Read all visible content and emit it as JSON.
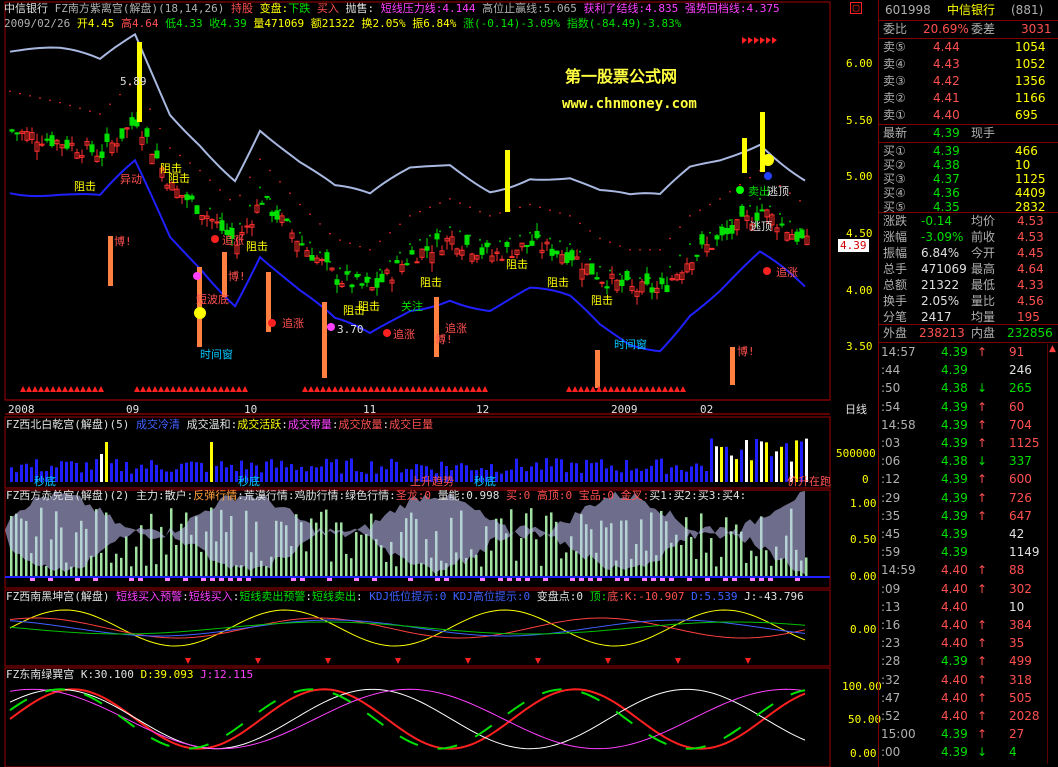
{
  "stock": {
    "name": "中信银行",
    "code": "601998",
    "seq": "(881)"
  },
  "top_title": {
    "name": "中信银行",
    "formula": "FZ南方紫离宫(解盘)",
    "params": "(18,14,26)",
    "hold": "持股",
    "change": "变盘:",
    "down": "下跌",
    "buy": "买入",
    "sell": "抛售:",
    "l1": "短线压力线:4.144",
    "l2": "高位止赢线:5.065",
    "l3": "获利了结线:4.835",
    "l4": "强势回档线:4.375"
  },
  "ohlc_line": {
    "date": "2009/02/26",
    "open": "开4.45",
    "high": "高4.64",
    "low": "低4.33",
    "close": "收4.39",
    "vol": "量471069",
    "amt": "额21322",
    "turn": "换2.05%",
    "amp": "振6.84%",
    "chg": "涨(-0.14)-3.09%",
    "idx": "指数(-84.49)-3.83%"
  },
  "watermark": {
    "line1": "第一股票公式网",
    "line2": "www.chnmoney.com"
  },
  "main_axis": [
    "6.00",
    "5.50",
    "5.00",
    "4.50",
    "4.00",
    "3.50"
  ],
  "price_tag": "4.39",
  "annot": {
    "peak": "5.89",
    "low": "3.70",
    "zuji": "阻击",
    "yidong": "异动",
    "zhuizhang": "追涨",
    "bo": "博!",
    "duanbo": "短波底",
    "shijian": "时间窗",
    "guanzhu": "关注",
    "mai": "卖出",
    "taoding": "逃顶",
    "ji": "击",
    "xiang": "向"
  },
  "time_axis": [
    "2008",
    "09",
    "10",
    "11",
    "12",
    "2009",
    "02"
  ],
  "day_label": "日线",
  "p2": {
    "title": "FZ西北白乾宫(解盘)(5)",
    "t1": "成交冷清",
    "t2": "成交温和",
    "t3": "成交活跃",
    "t4": "成交带量",
    "t5": "成交放量",
    "t6": "成交巨量",
    "axis": [
      "500000",
      "0"
    ],
    "a1": "秒底",
    "a2": "秒底",
    "a3": "上升趋势",
    "a4": "秒底",
    "a5": "价升在跑"
  },
  "p3": {
    "title": "FZ西方赤兑宫(解盘)(2)",
    "t1": "主力:散户",
    "t2": "反弹行情",
    "t3": "荒漠行情",
    "t4": "鸡肋行情",
    "t5": "绿色行情",
    "t6": "圣龙:0",
    "t7": "量能:0.998",
    "t8": "买:0",
    "t9": "高顶:0",
    "t10": "宝品:0",
    "t11": "金叉:",
    "t12": "买1:买2:买3:买4:",
    "axis": [
      "1.00",
      "0.50",
      "0.00"
    ]
  },
  "p4": {
    "title": "FZ西南黑坤宫(解盘)",
    "t1": "短线买入预警",
    "t2": "短线买入",
    "t3": "短线卖出预警",
    "t4": "短线卖出",
    "t5": "KDJ低位提示:0",
    "t6": "KDJ高位提示:0",
    "t7": "变盘点:0",
    "t8": "顶:",
    "t9": "底:",
    "t10": "K:-10.907",
    "t11": "D:5.539",
    "t12": "J:-43.796",
    "axis": [
      "0.00"
    ]
  },
  "p5": {
    "title": "FZ东南绿巽宫",
    "k": "K:30.100",
    "d": "D:39.093",
    "j": "J:12.115",
    "axis": [
      "100.00",
      "50.00",
      "0.00"
    ]
  },
  "side": {
    "weibi": {
      "label": "委比",
      "val": "20.69%",
      "lbl2": "委差",
      "val2": "3031"
    },
    "sell": [
      {
        "l": "卖⑤",
        "p": "4.44",
        "v": "1054"
      },
      {
        "l": "卖④",
        "p": "4.43",
        "v": "1052"
      },
      {
        "l": "卖③",
        "p": "4.42",
        "v": "1356"
      },
      {
        "l": "卖②",
        "p": "4.41",
        "v": "1166"
      },
      {
        "l": "卖①",
        "p": "4.40",
        "v": "695"
      }
    ],
    "last": {
      "l": "最新",
      "p": "4.39",
      "l2": "现手"
    },
    "buy": [
      {
        "l": "买①",
        "p": "4.39",
        "v": "466"
      },
      {
        "l": "买②",
        "p": "4.38",
        "v": "10"
      },
      {
        "l": "买③",
        "p": "4.37",
        "v": "1125"
      },
      {
        "l": "买④",
        "p": "4.36",
        "v": "4409"
      },
      {
        "l": "买⑤",
        "p": "4.35",
        "v": "2832"
      }
    ],
    "stats": [
      {
        "a": "涨跌",
        "b": "-0.14",
        "c": "均价",
        "d": "4.53"
      },
      {
        "a": "涨幅",
        "b": "-3.09%",
        "c": "前收",
        "d": "4.53"
      },
      {
        "a": "振幅",
        "b": "6.84%",
        "c": "今开",
        "d": "4.45"
      },
      {
        "a": "总手",
        "b": "471069",
        "c": "最高",
        "d": "4.64"
      },
      {
        "a": "总额",
        "b": "21322",
        "c": "最低",
        "d": "4.33"
      },
      {
        "a": "换手",
        "b": "2.05%",
        "c": "量比",
        "d": "4.56"
      },
      {
        "a": "分笔",
        "b": "2417",
        "c": "均量",
        "d": "195"
      }
    ],
    "wai": {
      "l": "外盘",
      "v": "238213",
      "l2": "内盘",
      "v2": "232856"
    },
    "ticks": [
      {
        "t": "14:57",
        "p": "4.39",
        "a": "↑",
        "v": "91"
      },
      {
        "t": ":44",
        "p": "4.39",
        "a": "",
        "v": "246"
      },
      {
        "t": ":50",
        "p": "4.38",
        "a": "↓",
        "v": "265"
      },
      {
        "t": ":54",
        "p": "4.39",
        "a": "↑",
        "v": "60"
      },
      {
        "t": "14:58",
        "p": "4.39",
        "a": "↑",
        "v": "704"
      },
      {
        "t": ":03",
        "p": "4.39",
        "a": "↑",
        "v": "1125"
      },
      {
        "t": ":06",
        "p": "4.38",
        "a": "↓",
        "v": "337"
      },
      {
        "t": ":12",
        "p": "4.39",
        "a": "↑",
        "v": "600"
      },
      {
        "t": ":29",
        "p": "4.39",
        "a": "↑",
        "v": "726"
      },
      {
        "t": ":35",
        "p": "4.39",
        "a": "↑",
        "v": "647"
      },
      {
        "t": ":45",
        "p": "4.39",
        "a": "",
        "v": "42"
      },
      {
        "t": ":59",
        "p": "4.39",
        "a": "",
        "v": "1149"
      },
      {
        "t": "14:59",
        "p": "4.40",
        "a": "↑",
        "v": "88"
      },
      {
        "t": ":09",
        "p": "4.40",
        "a": "↑",
        "v": "302"
      },
      {
        "t": ":13",
        "p": "4.40",
        "a": "",
        "v": "10"
      },
      {
        "t": ":16",
        "p": "4.40",
        "a": "↑",
        "v": "384"
      },
      {
        "t": ":23",
        "p": "4.40",
        "a": "↑",
        "v": "35"
      },
      {
        "t": ":28",
        "p": "4.39",
        "a": "↑",
        "v": "499"
      },
      {
        "t": ":32",
        "p": "4.40",
        "a": "↑",
        "v": "318"
      },
      {
        "t": ":47",
        "p": "4.40",
        "a": "↑",
        "v": "505"
      },
      {
        "t": ":52",
        "p": "4.40",
        "a": "↑",
        "v": "2028"
      },
      {
        "t": "15:00",
        "p": "4.39",
        "a": "↑",
        "v": "27"
      },
      {
        "t": ":00",
        "p": "4.39",
        "a": "↓",
        "v": "4"
      }
    ]
  },
  "colors": {
    "up": "#ff3030",
    "down": "#00e000",
    "blue": "#2020ff",
    "band": "#a8b8e0"
  }
}
